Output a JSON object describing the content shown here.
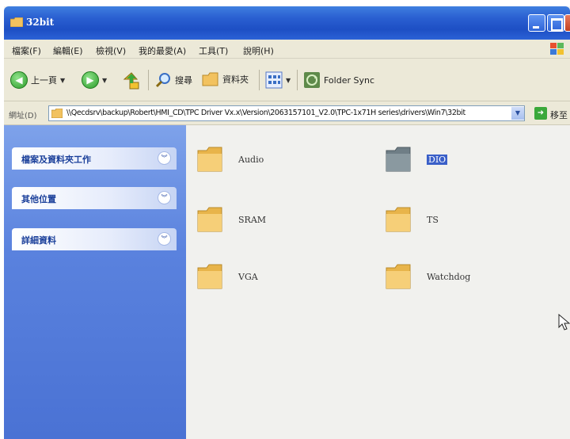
{
  "window": {
    "title": "32bit"
  },
  "menu": {
    "items": [
      "檔案(F)",
      "編輯(E)",
      "檢視(V)",
      "我的最愛(A)",
      "工具(T)",
      "說明(H)"
    ]
  },
  "toolbar": {
    "back_label": "上一頁",
    "search_label": "搜尋",
    "folders_label": "資料夾",
    "foldersync_label": "Folder Sync"
  },
  "address": {
    "label": "網址(D)",
    "path": "\\\\Qecdsrv\\backup\\Robert\\HMI_CD\\TPC Driver Vx.x\\Version\\2063157101_V2.0\\TPC-1x71H series\\drivers\\Win7\\32bit",
    "go_label": "移至"
  },
  "taskpane": {
    "groups": [
      {
        "title": "檔案及資料夾工作"
      },
      {
        "title": "其他位置"
      },
      {
        "title": "詳細資料"
      }
    ]
  },
  "folders": [
    {
      "name": "Audio",
      "selected": false
    },
    {
      "name": "DIO",
      "selected": true
    },
    {
      "name": "SRAM",
      "selected": false
    },
    {
      "name": "TS",
      "selected": false
    },
    {
      "name": "VGA",
      "selected": false
    },
    {
      "name": "Watchdog",
      "selected": false
    }
  ],
  "colors": {
    "titlebar": "#2a5fd1",
    "taskpane": "#5a82de",
    "folder": "#f2c25f",
    "folder_selected": "#7f8e95"
  }
}
